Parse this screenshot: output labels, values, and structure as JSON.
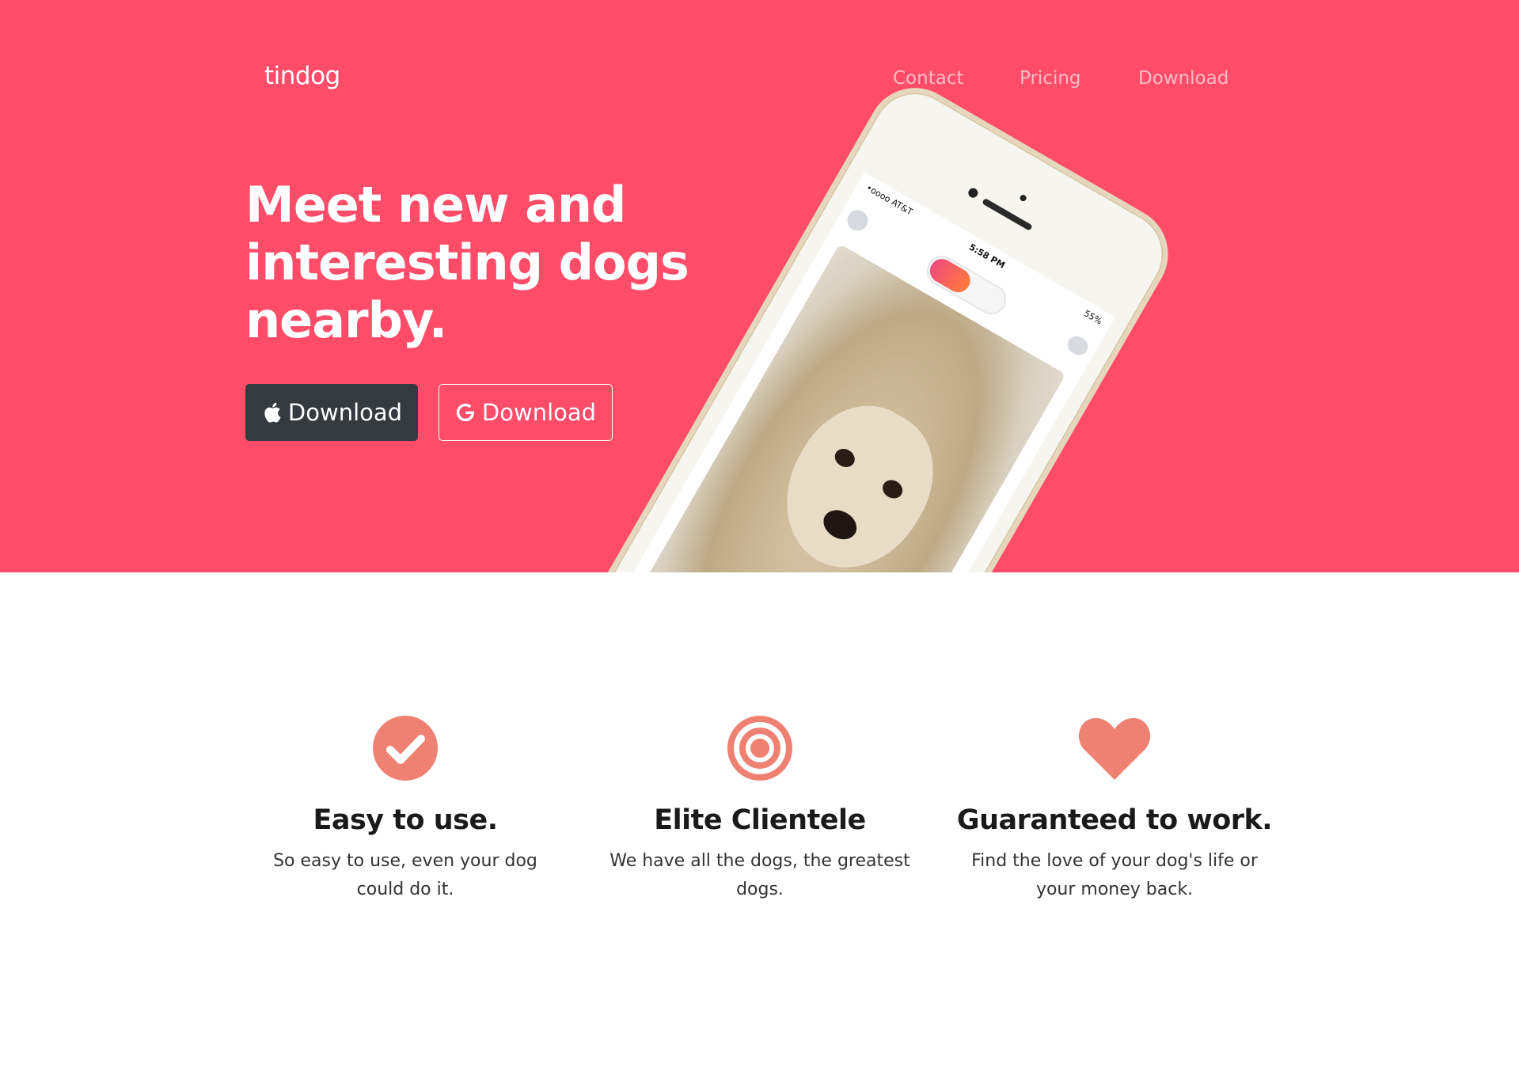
{
  "brand": "tindog",
  "nav": {
    "contact": "Contact",
    "pricing": "Pricing",
    "download": "Download"
  },
  "hero": {
    "headline": "Meet new and interesting dogs nearby.",
    "apple_button": "Download",
    "google_button": "Download"
  },
  "phone": {
    "carrier": "•oooo AT&T",
    "time": "5:58 PM",
    "battery": "55%"
  },
  "features": [
    {
      "icon": "check-circle-icon",
      "title": "Easy to use.",
      "text": "So easy to use, even your dog could do it."
    },
    {
      "icon": "bullseye-icon",
      "title": "Elite Clientele",
      "text": "We have all the dogs, the greatest dogs."
    },
    {
      "icon": "heart-icon",
      "title": "Guaranteed to work.",
      "text": "Find the love of your dog's life or your money back."
    }
  ],
  "colors": {
    "hero_background": "#ff4c68",
    "feature_icon": "#ef8172",
    "dark_button": "#343a40"
  }
}
